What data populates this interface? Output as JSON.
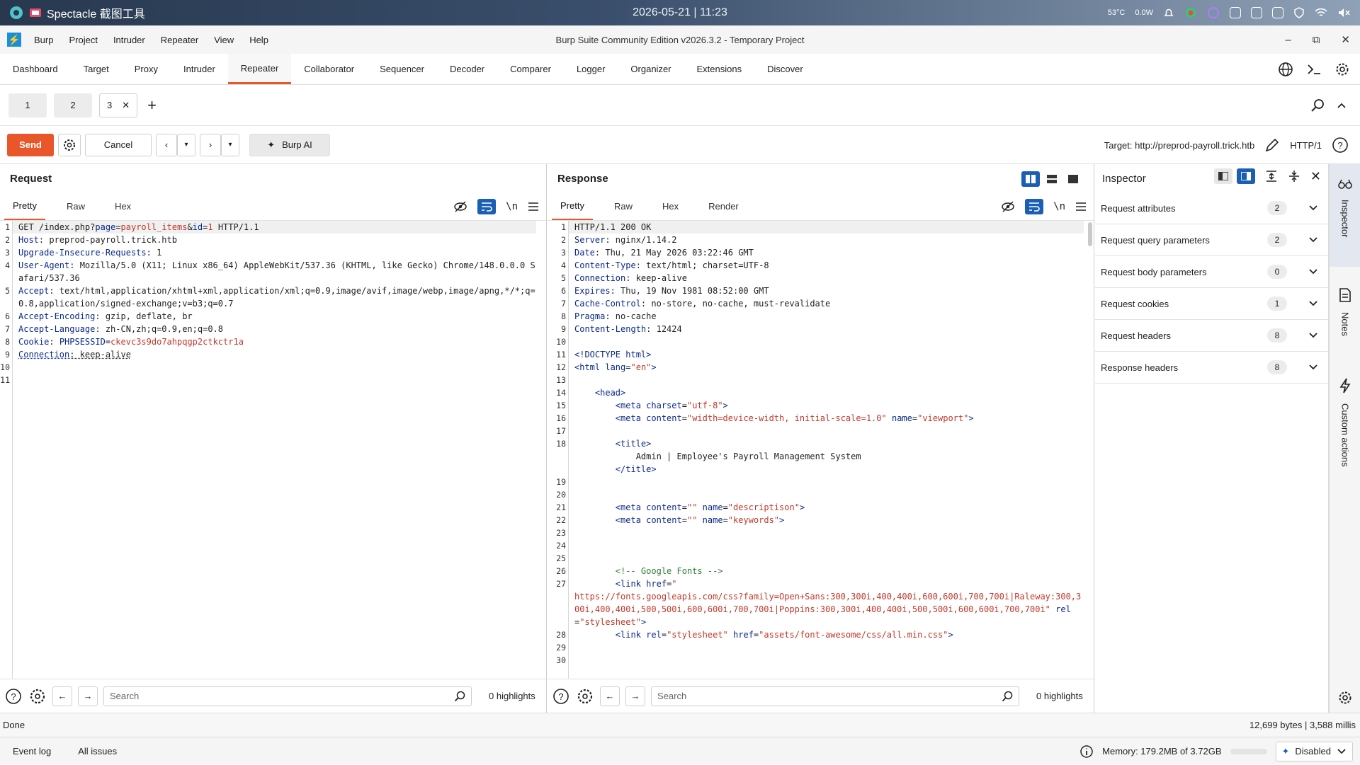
{
  "system": {
    "app_name": "Spectacle 截图工具",
    "clock": "2026-05-21 | 11:23",
    "temp": "53°C",
    "power": "0.0W"
  },
  "window": {
    "title": "Burp Suite Community Edition v2026.3.2 - Temporary Project",
    "menu": [
      "Burp",
      "Project",
      "Intruder",
      "Repeater",
      "View",
      "Help"
    ]
  },
  "main_tabs": {
    "items": [
      "Dashboard",
      "Target",
      "Proxy",
      "Intruder",
      "Repeater",
      "Collaborator",
      "Sequencer",
      "Decoder",
      "Comparer",
      "Logger",
      "Organizer",
      "Extensions",
      "Discover"
    ],
    "active": "Repeater"
  },
  "repeater_tabs": {
    "items": [
      "1",
      "2",
      "3"
    ],
    "active": "3"
  },
  "toolbar": {
    "send": "Send",
    "cancel": "Cancel",
    "burp_ai": "Burp AI",
    "target": "Target: http://preprod-payroll.trick.htb",
    "protocol": "HTTP/1"
  },
  "request": {
    "title": "Request",
    "tabs": [
      "Pretty",
      "Raw",
      "Hex"
    ],
    "active_tab": "Pretty",
    "lines": [
      {
        "n": "1",
        "html": "GET /index.php?<span class=\"hk\">page</span>=<span class=\"par\">payroll_items</span>&amp;<span class=\"hk\">id</span>=<span class=\"par\">1</span> HTTP/1.1",
        "hl": true
      },
      {
        "n": "2",
        "html": "<span class=\"hk\">Host</span>: preprod-payroll.trick.htb"
      },
      {
        "n": "3",
        "html": "<span class=\"hk\">Upgrade-Insecure-Requests</span>: 1"
      },
      {
        "n": "4",
        "html": "<span class=\"hk\">User-Agent</span>: Mozilla/5.0 (X11; Linux x86_64) AppleWebKit/537.36 (KHTML, like Gecko) Chrome/148.0.0.0 Safari/537.36"
      },
      {
        "n": "5",
        "html": "<span class=\"hk\">Accept</span>: text/html,application/xhtml+xml,application/xml;q=0.9,image/avif,image/webp,image/apng,*/*;q=0.8,application/signed-exchange;v=b3;q=0.7"
      },
      {
        "n": "6",
        "html": "<span class=\"hk\">Accept-Encoding</span>: gzip, deflate, br"
      },
      {
        "n": "7",
        "html": "<span class=\"hk\">Accept-Language</span>: zh-CN,zh;q=0.9,en;q=0.8"
      },
      {
        "n": "8",
        "html": "<span class=\"hk\">Cookie</span>: <span class=\"hk\">PHPSESSID</span>=<span class=\"par\">ckevc3s9do7ahpqgp2ctkctr1a</span>"
      },
      {
        "n": "9",
        "html": "<span class=\"hk\" style=\"text-decoration:underline dotted\">Connection</span><span style=\"text-decoration:underline dotted\">: keep-alive</span>"
      },
      {
        "n": "10",
        "html": ""
      },
      {
        "n": "11",
        "html": ""
      }
    ],
    "search_placeholder": "Search",
    "highlights": "0 highlights"
  },
  "response": {
    "title": "Response",
    "tabs": [
      "Pretty",
      "Raw",
      "Hex",
      "Render"
    ],
    "active_tab": "Pretty",
    "lines": [
      {
        "n": "1",
        "html": "HTTP/1.1 200 OK",
        "hl": true
      },
      {
        "n": "2",
        "html": "<span class=\"hk\">Server</span>: nginx/1.14.2"
      },
      {
        "n": "3",
        "html": "<span class=\"hk\">Date</span>: Thu, 21 May 2026 03:22:46 GMT"
      },
      {
        "n": "4",
        "html": "<span class=\"hk\">Content-Type</span>: text/html; charset=UTF-8"
      },
      {
        "n": "5",
        "html": "<span class=\"hk\">Connection</span>: keep-alive"
      },
      {
        "n": "6",
        "html": "<span class=\"hk\">Expires</span>: Thu, 19 Nov 1981 08:52:00 GMT"
      },
      {
        "n": "7",
        "html": "<span class=\"hk\">Cache-Control</span>: no-store, no-cache, must-revalidate"
      },
      {
        "n": "8",
        "html": "<span class=\"hk\">Pragma</span>: no-cache"
      },
      {
        "n": "9",
        "html": "<span class=\"hk\">Content-Length</span>: 12424"
      },
      {
        "n": "10",
        "html": ""
      },
      {
        "n": "11",
        "html": "<span class=\"tag\">&lt;!DOCTYPE html&gt;</span>"
      },
      {
        "n": "12",
        "html": "<span class=\"tag\">&lt;html</span> <span class=\"attr\">lang</span>=<span class=\"aval\">\"en\"</span><span class=\"tag\">&gt;</span>"
      },
      {
        "n": "13",
        "html": ""
      },
      {
        "n": "14",
        "html": "    <span class=\"tag\">&lt;head&gt;</span>"
      },
      {
        "n": "15",
        "html": "        <span class=\"tag\">&lt;meta</span> <span class=\"attr\">charset</span>=<span class=\"aval\">\"utf-8\"</span><span class=\"tag\">&gt;</span>"
      },
      {
        "n": "16",
        "html": "        <span class=\"tag\">&lt;meta</span> <span class=\"attr\">content</span>=<span class=\"aval\">\"width=device-width, initial-scale=1.0\"</span> <span class=\"attr\">name</span>=<span class=\"aval\">\"viewport\"</span><span class=\"tag\">&gt;</span>"
      },
      {
        "n": "17",
        "html": ""
      },
      {
        "n": "18",
        "html": "        <span class=\"tag\">&lt;title&gt;</span>\n            Admin | Employee's Payroll Management System\n        <span class=\"tag\">&lt;/title&gt;</span>"
      },
      {
        "n": "19",
        "html": ""
      },
      {
        "n": "20",
        "html": ""
      },
      {
        "n": "21",
        "html": "        <span class=\"tag\">&lt;meta</span> <span class=\"attr\">content</span>=<span class=\"aval\">\"\"</span> <span class=\"attr\">name</span>=<span class=\"aval\">\"descriptison\"</span><span class=\"tag\">&gt;</span>"
      },
      {
        "n": "22",
        "html": "        <span class=\"tag\">&lt;meta</span> <span class=\"attr\">content</span>=<span class=\"aval\">\"\"</span> <span class=\"attr\">name</span>=<span class=\"aval\">\"keywords\"</span><span class=\"tag\">&gt;</span>"
      },
      {
        "n": "23",
        "html": ""
      },
      {
        "n": "24",
        "html": ""
      },
      {
        "n": "25",
        "html": ""
      },
      {
        "n": "26",
        "html": "        <span class=\"cmt\">&lt;!-- Google Fonts --&gt;</span>"
      },
      {
        "n": "27",
        "html": "        <span class=\"tag\">&lt;link</span> <span class=\"attr\">href</span>=<span class=\"aval\">\"\nhttps://fonts.googleapis.com/css?family=Open+Sans:300,300i,400,400i,600,600i,700,700i|Raleway:300,300i,400,400i,500,500i,600,600i,700,700i|Poppins:300,300i,400,400i,500,500i,600,600i,700,700i\"</span> <span class=\"attr\">rel</span>=<span class=\"aval\">\"stylesheet\"</span><span class=\"tag\">&gt;</span>"
      },
      {
        "n": "28",
        "html": "        <span class=\"tag\">&lt;link</span> <span class=\"attr\">rel</span>=<span class=\"aval\">\"stylesheet\"</span> <span class=\"attr\">href</span>=<span class=\"aval\">\"assets/font-awesome/css/all.min.css\"</span><span class=\"tag\">&gt;</span>"
      },
      {
        "n": "29",
        "html": ""
      },
      {
        "n": "30",
        "html": ""
      }
    ],
    "search_placeholder": "Search",
    "highlights": "0 highlights"
  },
  "inspector": {
    "title": "Inspector",
    "rows": [
      {
        "label": "Request attributes",
        "count": "2"
      },
      {
        "label": "Request query parameters",
        "count": "2"
      },
      {
        "label": "Request body parameters",
        "count": "0"
      },
      {
        "label": "Request cookies",
        "count": "1"
      },
      {
        "label": "Request headers",
        "count": "8"
      },
      {
        "label": "Response headers",
        "count": "8"
      }
    ]
  },
  "side_strip": {
    "inspector": "Inspector",
    "notes": "Notes",
    "custom_actions": "Custom actions"
  },
  "status": {
    "left": "Done",
    "right": "12,699 bytes | 3,588 millis"
  },
  "bottom": {
    "event_log": "Event log",
    "all_issues": "All issues",
    "memory": "Memory: 179.2MB of 3.72GB",
    "ai_state": "Disabled"
  },
  "colors": {
    "accent": "#e8562a",
    "key": "#0b2a8a",
    "value": "#c0392b",
    "toggle_on": "#1a5fb4"
  }
}
